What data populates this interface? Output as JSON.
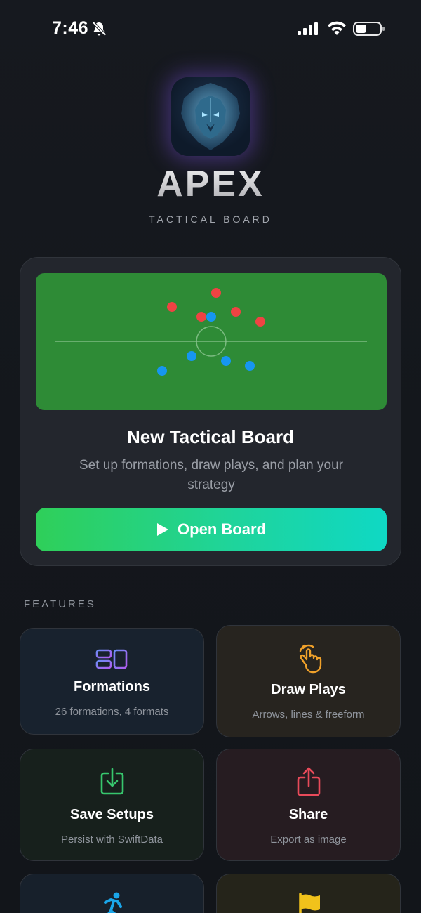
{
  "status_bar": {
    "time": "7:46",
    "icons": [
      "bell-slash-icon",
      "cellular-signal-icon",
      "wifi-icon",
      "battery-icon"
    ]
  },
  "app": {
    "icon": "lion-logo-icon",
    "title": "APEX",
    "subtitle": "TACTICAL BOARD"
  },
  "main_card": {
    "title": "New Tactical Board",
    "description": "Set up formations, draw plays, and plan your strategy",
    "button_label": "Open Board",
    "button_icon": "play-icon"
  },
  "features_section": {
    "label": "FEATURES",
    "items": [
      {
        "title": "Formations",
        "description": "26 formations, 4 formats",
        "icon": "formations-layout-icon",
        "color": "#8a6cf0"
      },
      {
        "title": "Draw Plays",
        "description": "Arrows, lines & freeform",
        "icon": "hand-tap-icon",
        "color": "#f0a12a"
      },
      {
        "title": "Save Setups",
        "description": "Persist with SwiftData",
        "icon": "tray-download-icon",
        "color": "#37c66d"
      },
      {
        "title": "Share",
        "description": "Export as image",
        "icon": "share-upload-icon",
        "color": "#e84a5a"
      },
      {
        "title": "",
        "description": "",
        "icon": "running-figure-icon",
        "color": "#1aa6ea"
      },
      {
        "title": "",
        "description": "",
        "icon": "flag-icon",
        "color": "#f1c21b"
      }
    ]
  },
  "colors": {
    "pitch": "#2e8b36",
    "team_red": "#ef4343",
    "team_blue": "#1696f0",
    "accent_start": "#2fcf59",
    "accent_end": "#0fd8c4"
  }
}
